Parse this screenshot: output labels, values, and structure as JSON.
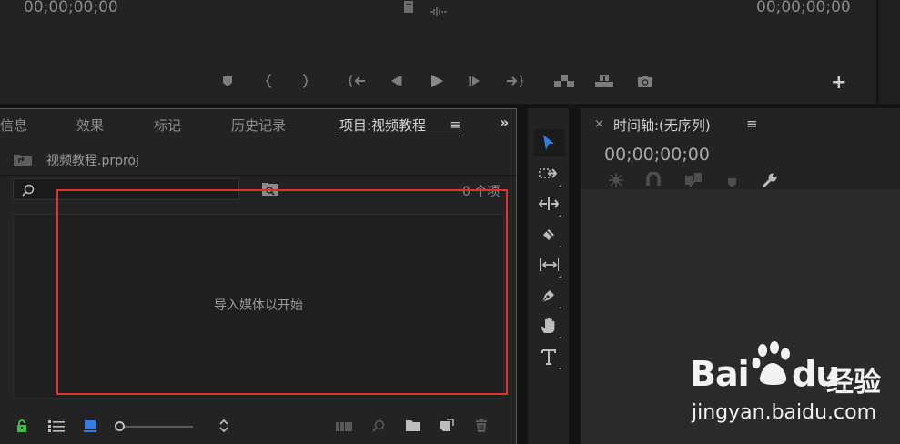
{
  "colors": {
    "accent": "#2f7fe6",
    "panel_focus_border": "#2e5fa5",
    "highlight_box": "#e0322e",
    "lock_green": "#3cbf4a",
    "watermark": "#f2f2f2"
  },
  "monitor": {
    "timecode_left": "00;00;00;00",
    "timecode_right": "00;00;00;00",
    "add_button": "+",
    "transport_icons": [
      "marker-icon",
      "mark-in-icon",
      "mark-out-icon",
      "go-to-in-icon",
      "step-back-icon",
      "play-icon",
      "step-forward-icon",
      "go-to-out-icon",
      "insert-icon",
      "overwrite-icon",
      "export-frame-icon"
    ]
  },
  "project": {
    "tabs": [
      {
        "label": "信息"
      },
      {
        "label": "效果"
      },
      {
        "label": "标记"
      },
      {
        "label": "历史记录"
      },
      {
        "label": "项目:视频教程",
        "active": true
      }
    ],
    "tab_menu": "≡",
    "tab_overflow": "»",
    "project_file": "视频教程.prproj",
    "item_count": "0 个项",
    "media_hint": "导入媒体以开始"
  },
  "tools": [
    "selection-tool",
    "track-select-tool",
    "ripple-edit-tool",
    "razor-tool",
    "slip-tool",
    "pen-tool",
    "hand-tool",
    "type-tool"
  ],
  "timeline": {
    "close": "×",
    "title": "时间轴:(无序列)",
    "menu": "≡",
    "timecode": "00;00;00;00"
  },
  "watermark": {
    "brand_a": "Bai",
    "brand_b": "du",
    "brand_c": "经验",
    "url": "jingyan.baidu.com"
  }
}
